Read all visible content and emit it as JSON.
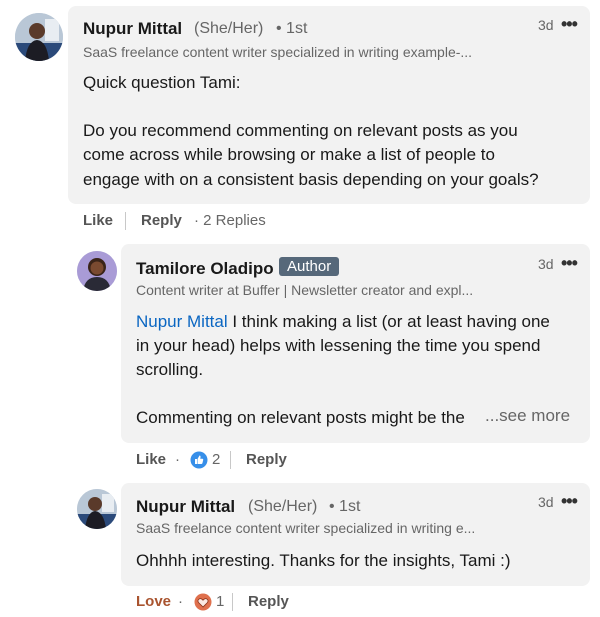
{
  "comments": [
    {
      "author": "Nupur Mittal",
      "pronouns": "(She/Her)",
      "degree": "• 1st",
      "headline": "SaaS freelance content writer specialized in writing example-...",
      "time": "3d",
      "text_lines": [
        "Quick question Tami:",
        "",
        "Do you recommend commenting on relevant posts as you",
        "come across while browsing or make a list of people to",
        "engage with on a consistent basis depending on your goals?"
      ],
      "actions": {
        "like": "Like",
        "reply": "Reply",
        "replies": "· 2 Replies"
      }
    },
    {
      "author": "Tamilore Oladipo",
      "badge": "Author",
      "headline": "Content writer at Buffer | Newsletter creator and expl...",
      "time": "3d",
      "mention": "Nupur Mittal",
      "text_lines": [
        " I think making a list (or at least having one",
        "in your head) helps with lessening the time you spend",
        "scrolling.",
        "",
        "Commenting on relevant posts might be the"
      ],
      "see_more": "...see more",
      "actions": {
        "like": "Like",
        "dot": "·",
        "reaction_count": "2",
        "reply": "Reply"
      }
    },
    {
      "author": "Nupur Mittal",
      "pronouns": "(She/Her)",
      "degree": "• 1st",
      "headline": "SaaS freelance content writer specialized in writing e...",
      "time": "3d",
      "text_lines": [
        "Ohhhh interesting. Thanks for the insights, Tami :)"
      ],
      "actions": {
        "like": "Love",
        "dot": "·",
        "reaction_count": "1",
        "reply": "Reply"
      }
    }
  ],
  "more_icon": "•••",
  "colors": {
    "bubble": "#f2f2f2",
    "mention": "#0a66c2",
    "love": "#a9542f",
    "like_blue": "#378fe9",
    "love_red": "#df704d"
  }
}
